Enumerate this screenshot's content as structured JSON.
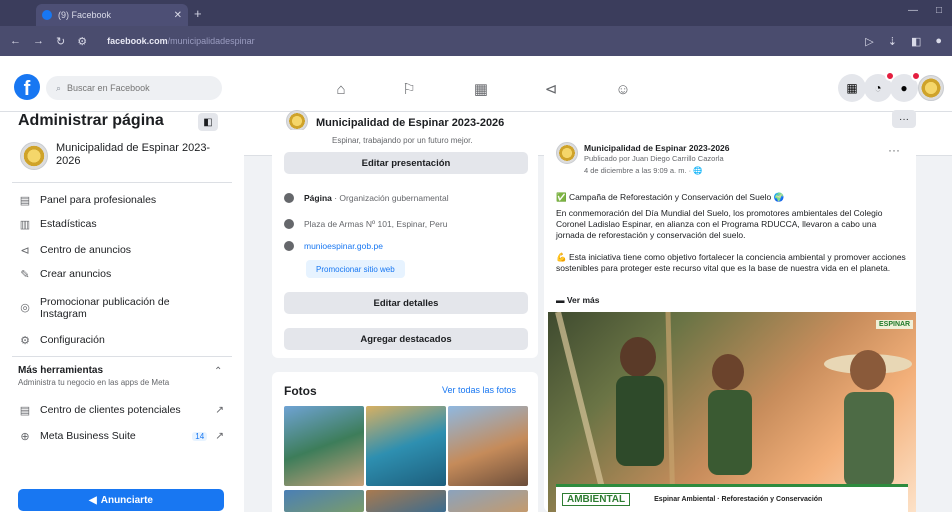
{
  "browser": {
    "tab_title": "(9) Facebook",
    "url_host": "facebook.com",
    "url_rest": "/municipalidadespinar"
  },
  "header": {
    "search_placeholder": "Buscar en Facebook"
  },
  "sidebar": {
    "title": "Administrar página",
    "page_name": "Municipalidad de Espinar 2023-2026",
    "items": [
      {
        "label": "Panel para profesionales",
        "icon": "dashboard-icon"
      },
      {
        "label": "Estadísticas",
        "icon": "chart-icon"
      },
      {
        "label": "Centro de anuncios",
        "icon": "megaphone-icon"
      },
      {
        "label": "Crear anuncios",
        "icon": "pencil-icon"
      },
      {
        "label": "Promocionar publicación de Instagram",
        "icon": "instagram-icon"
      },
      {
        "label": "Configuración",
        "icon": "gear-icon"
      }
    ],
    "more_tools_title": "Más herramientas",
    "more_tools_sub": "Administra tu negocio en las apps de Meta",
    "tools": [
      {
        "label": "Centro de clientes potenciales",
        "icon": "clients-icon"
      },
      {
        "label": "Meta Business Suite",
        "icon": "meta-icon",
        "badge": "14"
      }
    ],
    "promote_label": "Anunciarte"
  },
  "pagebar": {
    "page_name": "Municipalidad de Espinar 2023-2026",
    "more_label": "···"
  },
  "intro": {
    "top_text": "Espinar, trabajando por un futuro mejor.",
    "edit_presentation": "Editar presentación",
    "category_label": "Página",
    "category_value": " · Organización gubernamental",
    "address": "Plaza de Armas Nº 101, Espinar, Peru",
    "website": "munioespinar.gob.pe",
    "promote_website": "Promocionar sitio web",
    "edit_details": "Editar detalles",
    "add_featured": "Agregar destacados"
  },
  "photos": {
    "title": "Fotos",
    "see_all": "Ver todas las fotos"
  },
  "post": {
    "author": "Municipalidad de Espinar 2023-2026",
    "published_by": "Publicado por Juan Diego Carrillo Cazorla",
    "date": "4 de diciembre a las 9:09 a. m. · 🌐",
    "line1": "✅ Campaña de Reforestación y Conservación del Suelo 🌍",
    "paragraph1": "En conmemoración del Día Mundial del Suelo, los promotores ambientales del Colegio Coronel Ladislao Espinar, en alianza con el Programa RDUCCA, llevaron a cabo una jornada de reforestación y conservación del suelo.",
    "paragraph2": "💪 Esta iniciativa tiene como objetivo fortalecer la conciencia ambiental y promover acciones sostenibles para proteger este recurso vital que es la base de nuestra vida en el planeta.",
    "see_more": "▬ Ver más",
    "image_badge": "AMBIENTAL",
    "image_caption": "Espinar Ambiental · Reforestación y Conservación",
    "image_logo": "ESPINAR"
  },
  "colors": {
    "brand": "#1877f2",
    "chrome": "#3b3d5c",
    "notification": "#e41e3f"
  }
}
